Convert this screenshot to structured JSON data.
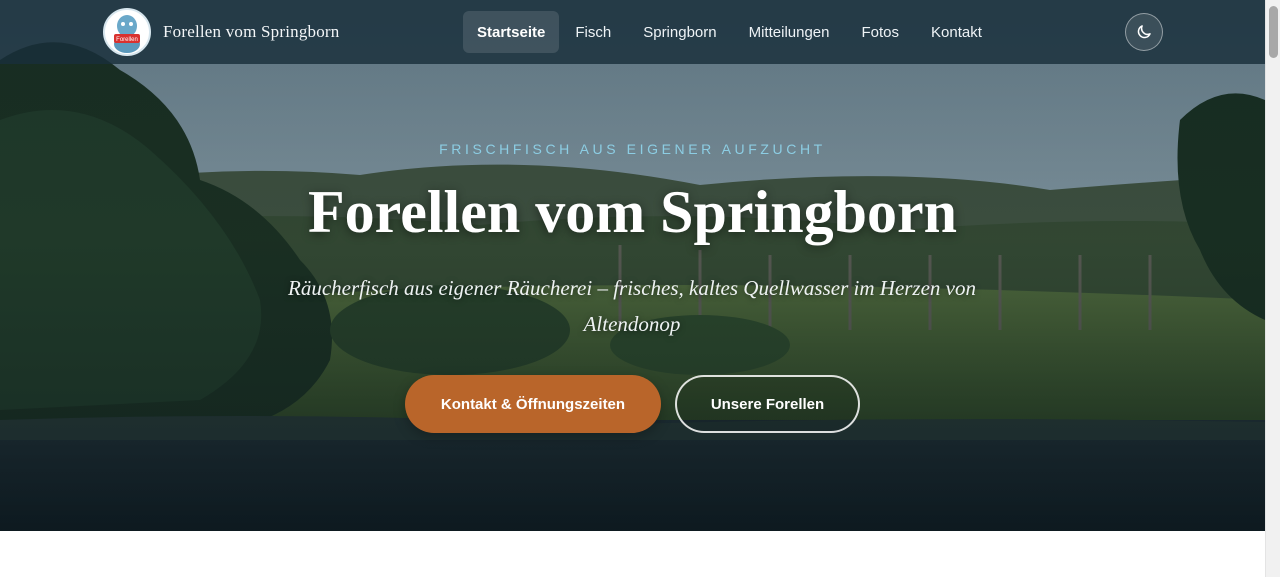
{
  "brand": {
    "name": "Forellen vom Springborn",
    "logo_text": "Forellen"
  },
  "nav": {
    "items": [
      {
        "label": "Startseite",
        "active": true
      },
      {
        "label": "Fisch"
      },
      {
        "label": "Springborn"
      },
      {
        "label": "Mitteilungen"
      },
      {
        "label": "Fotos"
      },
      {
        "label": "Kontakt"
      }
    ],
    "theme_toggle_icon": "moon-icon"
  },
  "hero": {
    "eyebrow": "FRISCHFISCH AUS EIGENER AUFZUCHT",
    "title": "Forellen vom Springborn",
    "subtitle": "Räucherfisch aus eigener Räucherei – frisches, kaltes Quellwasser im Herzen von Altendonop",
    "primary_button": "Kontakt & Öffnungszeiten",
    "secondary_button": "Unsere Forellen"
  },
  "colors": {
    "accent": "#b9652a",
    "eyebrow": "#8ccde3",
    "nav_bg": "#182e3a"
  }
}
